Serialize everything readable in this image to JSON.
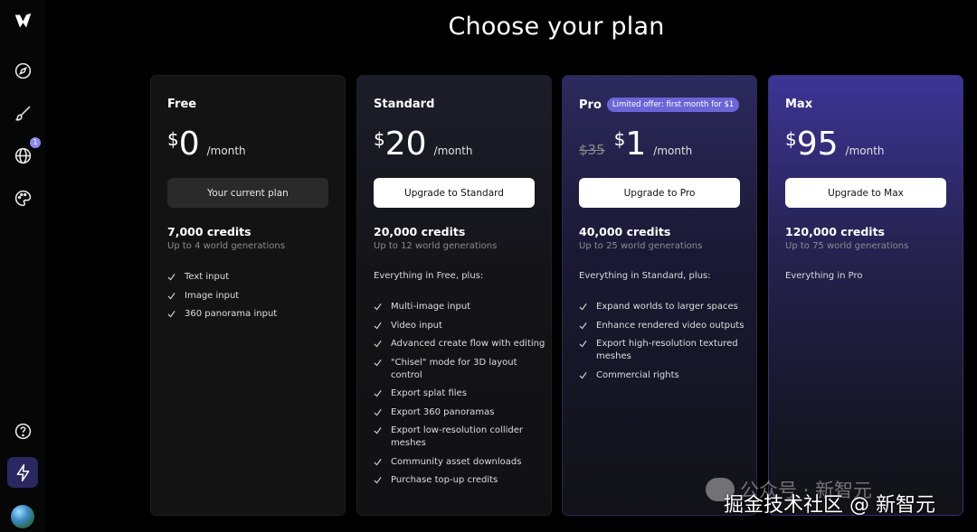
{
  "page_title": "Choose your plan",
  "sidebar": {
    "items": [
      {
        "icon": "logo-icon"
      },
      {
        "icon": "compass-icon"
      },
      {
        "icon": "brush-icon"
      },
      {
        "icon": "globe-icon",
        "badge": "1"
      },
      {
        "icon": "palette-icon"
      },
      {
        "icon": "help-icon"
      },
      {
        "icon": "lightning-icon"
      },
      {
        "icon": "avatar"
      }
    ]
  },
  "plans": {
    "free": {
      "name": "Free",
      "currency": "$",
      "amount": "0",
      "per": "/month",
      "cta": "Your current plan",
      "credits": "7,000 credits",
      "generations": "Up to 4 world generations",
      "intro": "",
      "features": [
        "Text input",
        "Image input",
        "360 panorama input"
      ]
    },
    "standard": {
      "name": "Standard",
      "currency": "$",
      "amount": "20",
      "per": "/month",
      "cta": "Upgrade to Standard",
      "credits": "20,000 credits",
      "generations": "Up to 12 world generations",
      "intro": "Everything in Free, plus:",
      "features": [
        "Multi-image input",
        "Video input",
        "Advanced create flow with editing",
        "\"Chisel\" mode for 3D layout control",
        "Export splat files",
        "Export 360 panoramas",
        "Export low-resolution collider meshes",
        "Community asset downloads",
        "Purchase top-up credits"
      ]
    },
    "pro": {
      "name": "Pro",
      "badge": "Limited offer: first month for $1",
      "old_price": "$35",
      "currency": "$",
      "amount": "1",
      "per": "/month",
      "cta": "Upgrade to Pro",
      "credits": "40,000 credits",
      "generations": "Up to 25 world generations",
      "intro": "Everything in Standard, plus:",
      "features": [
        "Expand worlds to larger spaces",
        "Enhance rendered video outputs",
        "Export high-resolution textured meshes",
        "Commercial rights"
      ]
    },
    "max": {
      "name": "Max",
      "currency": "$",
      "amount": "95",
      "per": "/month",
      "cta": "Upgrade to Max",
      "credits": "120,000 credits",
      "generations": "Up to 75 world generations",
      "intro": "Everything in Pro"
    }
  },
  "watermark": {
    "line1": "公众号 · 新智元",
    "line2": "掘金技术社区 @ 新智元"
  },
  "colors": {
    "background": "#000000",
    "pro_badge": "#6a66d8",
    "active_sidebar": "#2a2762"
  }
}
